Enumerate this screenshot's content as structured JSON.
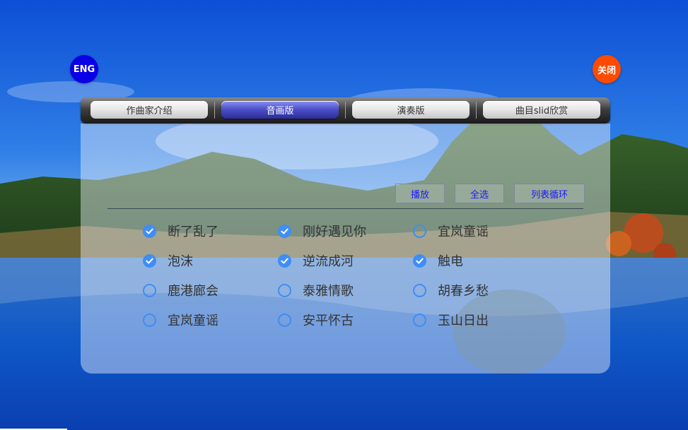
{
  "buttons": {
    "lang": "ENG",
    "close": "关闭"
  },
  "tabs": [
    {
      "label": "作曲家介绍",
      "active": false
    },
    {
      "label": "音画版",
      "active": true
    },
    {
      "label": "演奏版",
      "active": false
    },
    {
      "label": "曲目slid欣赏",
      "active": false
    }
  ],
  "toolbar": {
    "play": "播放",
    "select_all": "全选",
    "loop": "列表循环"
  },
  "songs": [
    {
      "title": "断了乱了",
      "checked": true
    },
    {
      "title": "刚好遇见你",
      "checked": true
    },
    {
      "title": "宜岚童谣",
      "checked": false
    },
    {
      "title": "泡沫",
      "checked": true
    },
    {
      "title": "逆流成河",
      "checked": true
    },
    {
      "title": "触电",
      "checked": true
    },
    {
      "title": "鹿港廊会",
      "checked": false
    },
    {
      "title": "泰雅情歌",
      "checked": false
    },
    {
      "title": "胡春乡愁",
      "checked": false
    },
    {
      "title": "宜岚童谣",
      "checked": false
    },
    {
      "title": "安平怀古",
      "checked": false
    },
    {
      "title": "玉山日出",
      "checked": false
    }
  ],
  "colors": {
    "accent": "#3f8df5",
    "eng_button": "#0a00e6",
    "close_button": "#ff4a00",
    "active_tab": "#4a4dc6",
    "toolbar_text": "#1a1aff"
  }
}
